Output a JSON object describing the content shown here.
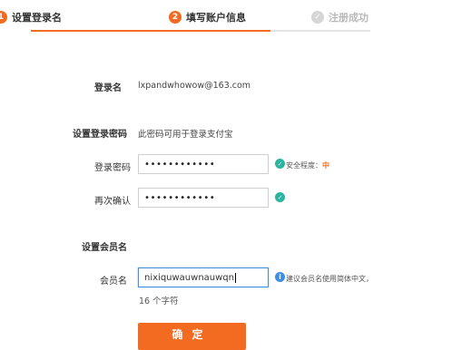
{
  "steps": [
    {
      "number": "1",
      "label": "设置登录名"
    },
    {
      "number": "2",
      "label": "填写账户信息"
    },
    {
      "number": "✓",
      "label": "注册成功"
    }
  ],
  "account": {
    "login_label": "登录名",
    "login_value": "lxpandwhowow@163.com"
  },
  "password_section": {
    "title": "设置登录密码",
    "note": "此密码可用于登录支付宝",
    "password_label": "登录密码",
    "password_value": "••••••••••••",
    "strength_label": "安全程度：",
    "strength_value": "中",
    "confirm_label": "再次确认",
    "confirm_value": "••••••••••••"
  },
  "member_section": {
    "title": "设置会员名",
    "member_label": "会员名",
    "member_value": "nixiquwauwnauwqn",
    "hint": "建议会员名使用简体中文，",
    "char_count": "16 个字符"
  },
  "confirm_button": "确定",
  "colors": {
    "accent": "#f26b21",
    "success": "#2bb5a0",
    "info": "#3a8ee6"
  }
}
